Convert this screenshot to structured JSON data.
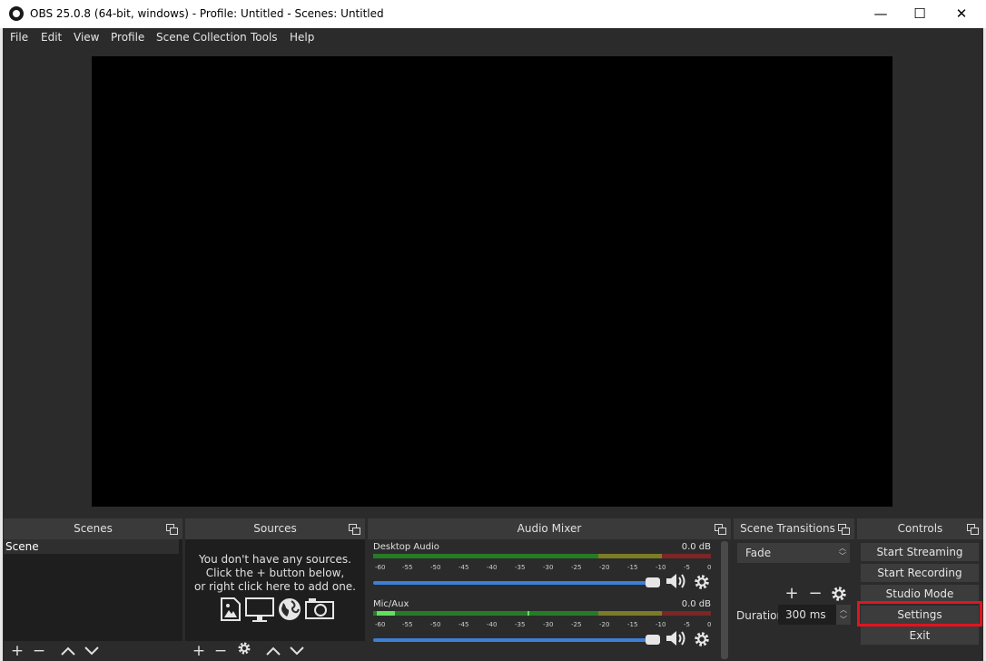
{
  "window": {
    "title": "OBS 25.0.8 (64-bit, windows) - Profile: Untitled - Scenes: Untitled",
    "minimize": "—",
    "maximize": "☐",
    "close": "✕"
  },
  "menu": [
    "File",
    "Edit",
    "View",
    "Profile",
    "Scene Collection",
    "Tools",
    "Help"
  ],
  "docks": {
    "scenes": {
      "title": "Scenes",
      "items": [
        "Scene"
      ]
    },
    "sources": {
      "title": "Sources",
      "empty_line1": "You don't have any sources.",
      "empty_line2": "Click the + button below,",
      "empty_line3": "or right click here to add one."
    },
    "mixer": {
      "title": "Audio Mixer",
      "channels": [
        {
          "name": "Desktop Audio",
          "level": "0.0 dB"
        },
        {
          "name": "Mic/Aux",
          "level": "0.0 dB"
        }
      ],
      "ticks": [
        "-60",
        "-55",
        "-50",
        "-45",
        "-40",
        "-35",
        "-30",
        "-25",
        "-20",
        "-15",
        "-10",
        "-5",
        "0"
      ]
    },
    "transitions": {
      "title": "Scene Transitions",
      "selected": "Fade",
      "duration_label": "Duration",
      "duration_value": "300 ms"
    },
    "controls": {
      "title": "Controls",
      "start_streaming": "Start Streaming",
      "start_recording": "Start Recording",
      "studio_mode": "Studio Mode",
      "settings": "Settings",
      "exit": "Exit"
    }
  },
  "colors": {
    "highlight": "#e0151f",
    "accent": "#3c7fd6"
  }
}
